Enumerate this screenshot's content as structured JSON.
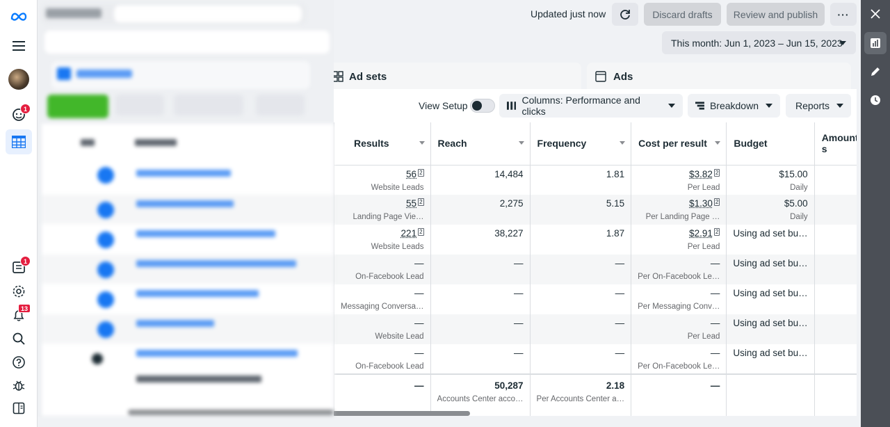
{
  "header": {
    "updated_text": "Updated just now",
    "discard_label": "Discard drafts",
    "review_label": "Review and publish",
    "more_label": "···"
  },
  "date_range": {
    "label": "This month: Jun 1, 2023 – Jun 15, 2023"
  },
  "tabs": {
    "adsets_label": "Ad sets",
    "ads_label": "Ads"
  },
  "toolbar": {
    "view_setup_label": "View Setup",
    "columns_label": "Columns: Performance and clicks",
    "breakdown_label": "Breakdown",
    "reports_label": "Reports"
  },
  "rail": {
    "notifications_badge": "1",
    "reports_badge": "1",
    "alerts_badge": "13"
  },
  "table": {
    "columns": [
      "Results",
      "Reach",
      "Frequency",
      "Cost per result",
      "Budget",
      "Amount s"
    ],
    "rows": [
      {
        "results": "56",
        "results_sub": "Website Leads",
        "reach": "14,484",
        "frequency": "1.81",
        "cost": "$3.82",
        "cost_sub": "Per Lead",
        "budget": "$15.00",
        "budget_sub": "Daily"
      },
      {
        "results": "55",
        "results_sub": "Landing Page Vie…",
        "reach": "2,275",
        "frequency": "5.15",
        "cost": "$1.30",
        "cost_sub": "Per Landing Page …",
        "budget": "$5.00",
        "budget_sub": "Daily"
      },
      {
        "results": "221",
        "results_sub": "Website Leads",
        "reach": "38,227",
        "frequency": "1.87",
        "cost": "$2.91",
        "cost_sub": "Per Lead",
        "budget": "Using ad set bu…",
        "budget_sub": ""
      },
      {
        "results": "—",
        "results_sub": "On-Facebook Lead",
        "reach": "—",
        "frequency": "—",
        "cost": "—",
        "cost_sub": "Per On-Facebook Le…",
        "budget": "Using ad set bu…",
        "budget_sub": ""
      },
      {
        "results": "—",
        "results_sub": "Messaging Conversa…",
        "reach": "—",
        "frequency": "—",
        "cost": "—",
        "cost_sub": "Per Messaging Conv…",
        "budget": "Using ad set bu…",
        "budget_sub": ""
      },
      {
        "results": "—",
        "results_sub": "Website Lead",
        "reach": "—",
        "frequency": "—",
        "cost": "—",
        "cost_sub": "Per Lead",
        "budget": "Using ad set bu…",
        "budget_sub": ""
      },
      {
        "results": "—",
        "results_sub": "On-Facebook Lead",
        "reach": "—",
        "frequency": "—",
        "cost": "—",
        "cost_sub": "Per On-Facebook Le…",
        "budget": "Using ad set bu…",
        "budget_sub": ""
      }
    ],
    "total": {
      "results": "—",
      "reach": "50,287",
      "reach_sub": "Accounts Center acco…",
      "frequency": "2.18",
      "frequency_sub": "Per Accounts Center a…",
      "cost": "—"
    }
  },
  "colors": {
    "accent": "#1877f2",
    "create_green": "#42b72a",
    "panel_dark": "#4b4f56",
    "badge_red": "#e41e3f"
  }
}
